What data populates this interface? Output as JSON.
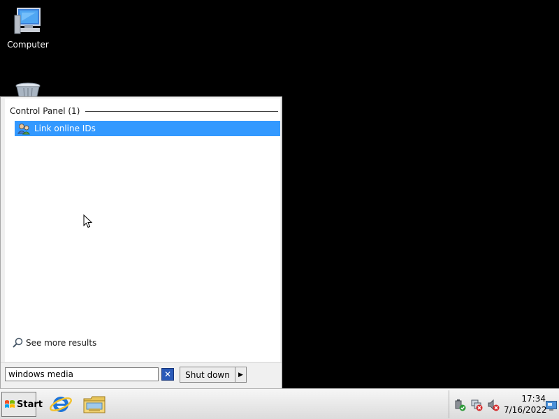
{
  "desktop": {
    "icons": [
      {
        "label": "Computer",
        "icon": "computer-icon"
      },
      {
        "label": "",
        "icon": "recycle-bin-icon"
      }
    ]
  },
  "start_menu": {
    "section_header": "Control Panel (1)",
    "results": [
      {
        "label": "Link online IDs",
        "icon": "link-online-ids-icon",
        "selected": true
      }
    ],
    "see_more_label": "See more results",
    "search": {
      "value": "windows media",
      "placeholder": ""
    },
    "shutdown_label": "Shut down"
  },
  "taskbar": {
    "start_label": "Start",
    "apps": [
      {
        "name": "internet-explorer-icon"
      },
      {
        "name": "windows-explorer-icon"
      }
    ],
    "clock": {
      "time": "17:34",
      "date": "7/16/2022"
    }
  },
  "colors": {
    "desktop_bg": "#000000",
    "selection": "#3399ff",
    "menu_bg": "#f0f0f0"
  }
}
